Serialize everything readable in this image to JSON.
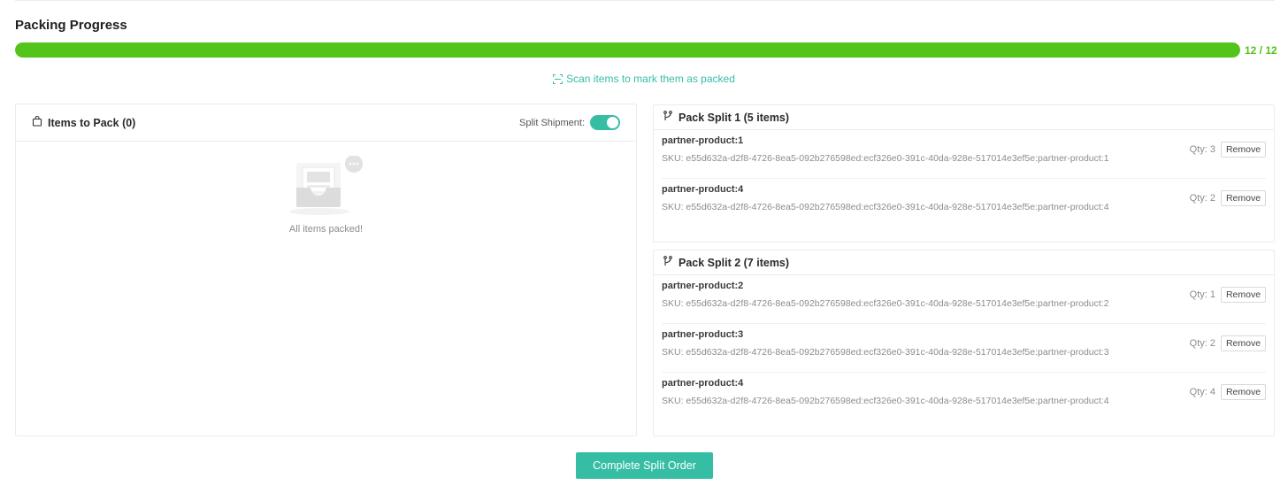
{
  "colors": {
    "progress": "#52c41a",
    "accent": "#36bea5"
  },
  "packing": {
    "title": "Packing Progress",
    "progress_fraction": 1.0,
    "count_label": "12 / 12",
    "scan_hint": "Scan items to mark them as packed"
  },
  "items_panel": {
    "title": "Items to Pack (0)",
    "split_label": "Split Shipment:",
    "split_enabled": true,
    "empty_text": "All items packed!"
  },
  "splits": [
    {
      "title": "Pack Split 1 (5 items)",
      "items": [
        {
          "name": "partner-product:1",
          "sku": "SKU: e55d632a-d2f8-4726-8ea5-092b276598ed:ecf326e0-391c-40da-928e-517014e3ef5e:partner-product:1",
          "qty": "Qty: 3",
          "remove": "Remove"
        },
        {
          "name": "partner-product:4",
          "sku": "SKU: e55d632a-d2f8-4726-8ea5-092b276598ed:ecf326e0-391c-40da-928e-517014e3ef5e:partner-product:4",
          "qty": "Qty: 2",
          "remove": "Remove"
        }
      ]
    },
    {
      "title": "Pack Split 2 (7 items)",
      "items": [
        {
          "name": "partner-product:2",
          "sku": "SKU: e55d632a-d2f8-4726-8ea5-092b276598ed:ecf326e0-391c-40da-928e-517014e3ef5e:partner-product:2",
          "qty": "Qty: 1",
          "remove": "Remove"
        },
        {
          "name": "partner-product:3",
          "sku": "SKU: e55d632a-d2f8-4726-8ea5-092b276598ed:ecf326e0-391c-40da-928e-517014e3ef5e:partner-product:3",
          "qty": "Qty: 2",
          "remove": "Remove"
        },
        {
          "name": "partner-product:4",
          "sku": "SKU: e55d632a-d2f8-4726-8ea5-092b276598ed:ecf326e0-391c-40da-928e-517014e3ef5e:partner-product:4",
          "qty": "Qty: 4",
          "remove": "Remove"
        }
      ]
    }
  ],
  "complete_label": "Complete Split Order"
}
